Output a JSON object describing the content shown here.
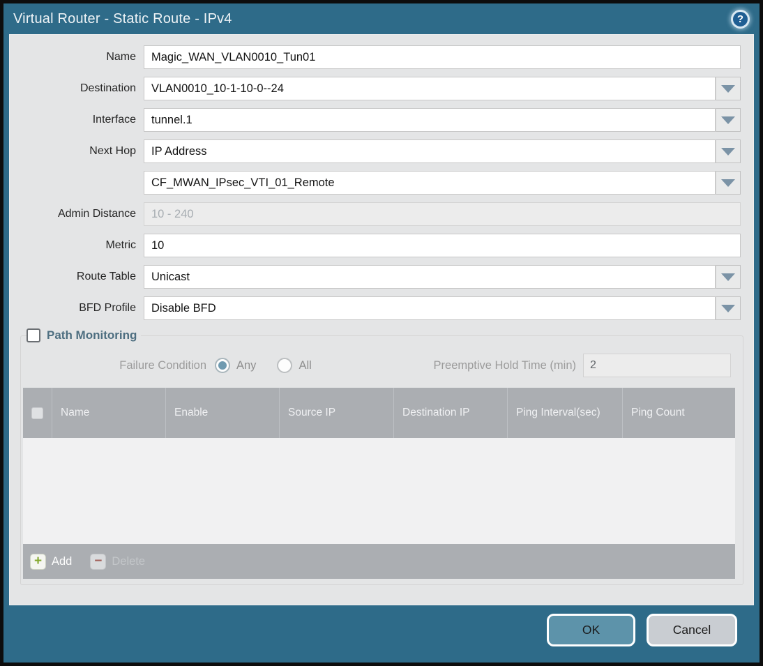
{
  "window": {
    "title": "Virtual Router - Static Route - IPv4",
    "help_icon": "?"
  },
  "colors": {
    "frame_teal": "#2e6b89",
    "panel_grey": "#e4e5e6",
    "table_header_grey": "#abaeb2",
    "ok_button": "#5d93aa",
    "cancel_button": "#c9cdd2",
    "radio_selected": "#6f9ab0",
    "pm_title": "#4d6e80",
    "add_plus_green": "#85a92f",
    "delete_minus_red": "#a2605a"
  },
  "form": {
    "fields": [
      {
        "label": "Name",
        "value": "Magic_WAN_VLAN0010_Tun01",
        "type": "text"
      },
      {
        "label": "Destination",
        "value": "VLAN0010_10-1-10-0--24",
        "type": "dropdown"
      },
      {
        "label": "Interface",
        "value": "tunnel.1",
        "type": "dropdown"
      },
      {
        "label": "Next Hop",
        "value": "IP Address",
        "type": "dropdown"
      },
      {
        "label": "",
        "value": "CF_MWAN_IPsec_VTI_01_Remote",
        "type": "dropdown"
      },
      {
        "label": "Admin Distance",
        "value": "",
        "placeholder": "10 - 240",
        "type": "text-disabled"
      },
      {
        "label": "Metric",
        "value": "10",
        "type": "text"
      },
      {
        "label": "Route Table",
        "value": "Unicast",
        "type": "dropdown"
      },
      {
        "label": "BFD Profile",
        "value": "Disable BFD",
        "type": "dropdown"
      }
    ]
  },
  "path_monitoring": {
    "title": "Path Monitoring",
    "checkbox_checked": false,
    "failure_condition_label": "Failure Condition",
    "options": [
      {
        "label": "Any",
        "selected": true
      },
      {
        "label": "All",
        "selected": false
      }
    ],
    "preemptive_label": "Preemptive Hold Time (min)",
    "preemptive_value": "2",
    "table": {
      "columns": [
        "Name",
        "Enable",
        "Source IP",
        "Destination IP",
        "Ping Interval(sec)",
        "Ping Count"
      ],
      "rows": []
    },
    "add_label": "Add",
    "delete_label": "Delete"
  },
  "footer": {
    "ok_label": "OK",
    "cancel_label": "Cancel"
  }
}
